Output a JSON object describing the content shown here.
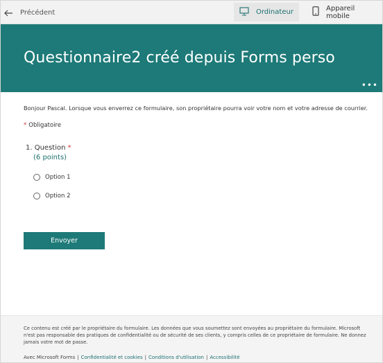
{
  "topbar": {
    "back_label": "Précédent",
    "desktop_label": "Ordinateur",
    "mobile_label": "Appareil mobile",
    "icons": {
      "back": "arrow-left-icon",
      "desktop": "monitor-icon",
      "mobile": "phone-icon"
    }
  },
  "banner": {
    "title": "Questionnaire2 créé depuis Forms perso",
    "more": "•••",
    "color": "#1d7a78"
  },
  "form": {
    "intro": "Bonjour Pascal. Lorsque vous enverrez ce formulaire, son propriétaire pourra voir votre nom et votre adresse de courrier.",
    "required_star": "*",
    "required_label": "Obligatoire",
    "question": {
      "title": "1. Question",
      "star": "*",
      "points": "(6 points)",
      "options": [
        "Option 1",
        "Option 2"
      ]
    },
    "submit_label": "Envoyer"
  },
  "footer": {
    "disclaimer": "Ce contenu est créé par le propriétaire du formulaire. Les données que vous soumettez sont envoyées au propriétaire du formulaire. Microsoft n'est pas responsable des pratiques de confidentialité ou de sécurité de ses clients, y compris celles de ce propriétaire de formulaire. Ne donnez jamais votre mot de passe.",
    "brand": "Avec Microsoft Forms",
    "links": [
      "Confidentialité et cookies",
      "Conditions d'utilisation",
      "Accessibilité"
    ],
    "separator": "|"
  },
  "colors": {
    "accent": "#1d7a78",
    "required": "#d13438"
  }
}
